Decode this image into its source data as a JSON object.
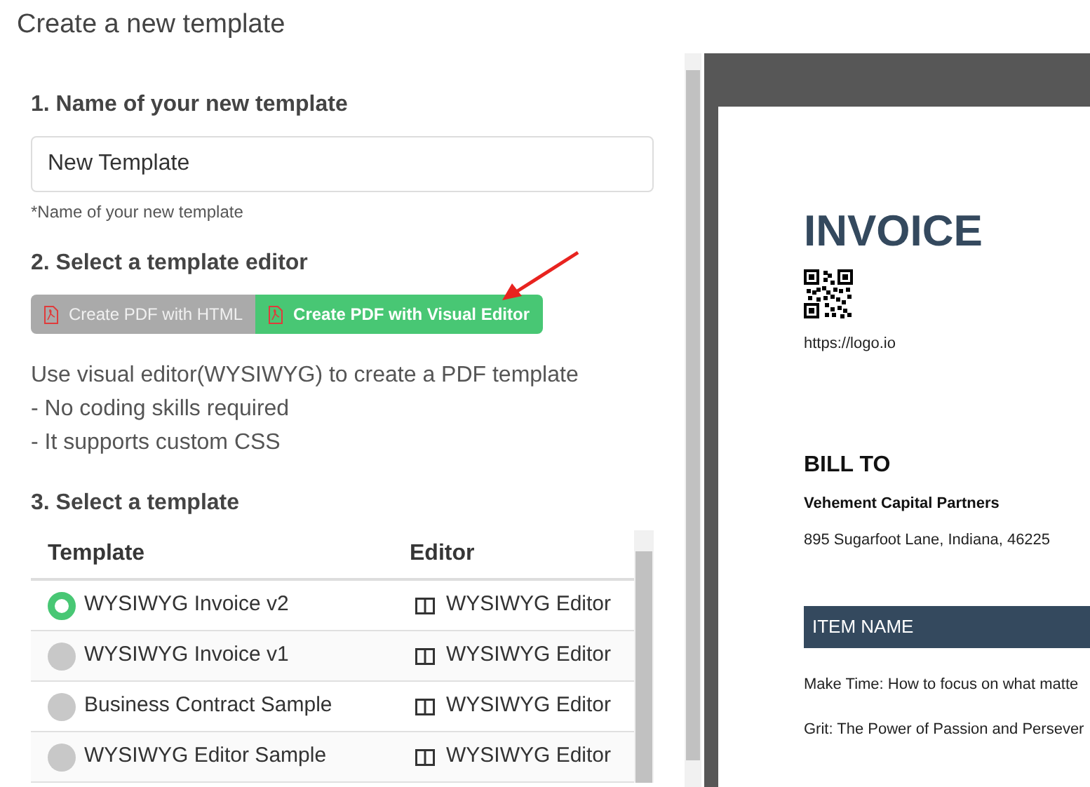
{
  "page_title": "Create a new template",
  "step_name": {
    "heading": "1. Name of your new template",
    "value": "New Template",
    "hint": "*Name of your new template"
  },
  "step_editor": {
    "heading": "2. Select a template editor",
    "buttons": [
      {
        "label": "Create PDF with HTML",
        "selected": false
      },
      {
        "label": "Create PDF with Visual Editor",
        "selected": true
      }
    ],
    "description": [
      "Use visual editor(WYSIWYG) to create a PDF template",
      "- No coding skills required",
      "- It supports custom CSS"
    ]
  },
  "step_template": {
    "heading": "3. Select a template",
    "columns": [
      "Template",
      "Editor"
    ],
    "rows": [
      {
        "name": "WYSIWYG Invoice v2",
        "editor": "WYSIWYG Editor",
        "selected": true
      },
      {
        "name": "WYSIWYG Invoice v1",
        "editor": "WYSIWYG Editor",
        "selected": false
      },
      {
        "name": "Business Contract Sample",
        "editor": "WYSIWYG Editor",
        "selected": false
      },
      {
        "name": "WYSIWYG Editor Sample",
        "editor": "WYSIWYG Editor",
        "selected": false
      }
    ]
  },
  "preview": {
    "title": "INVOICE",
    "url": "https://logo.io",
    "bill_to_heading": "BILL TO",
    "company": "Vehement Capital Partners",
    "address": "895 Sugarfoot Lane, Indiana, 46225",
    "item_heading": "ITEM NAME",
    "items": [
      "Make Time: How to focus on what matte",
      "Grit: The Power of Passion and Persever"
    ]
  }
}
